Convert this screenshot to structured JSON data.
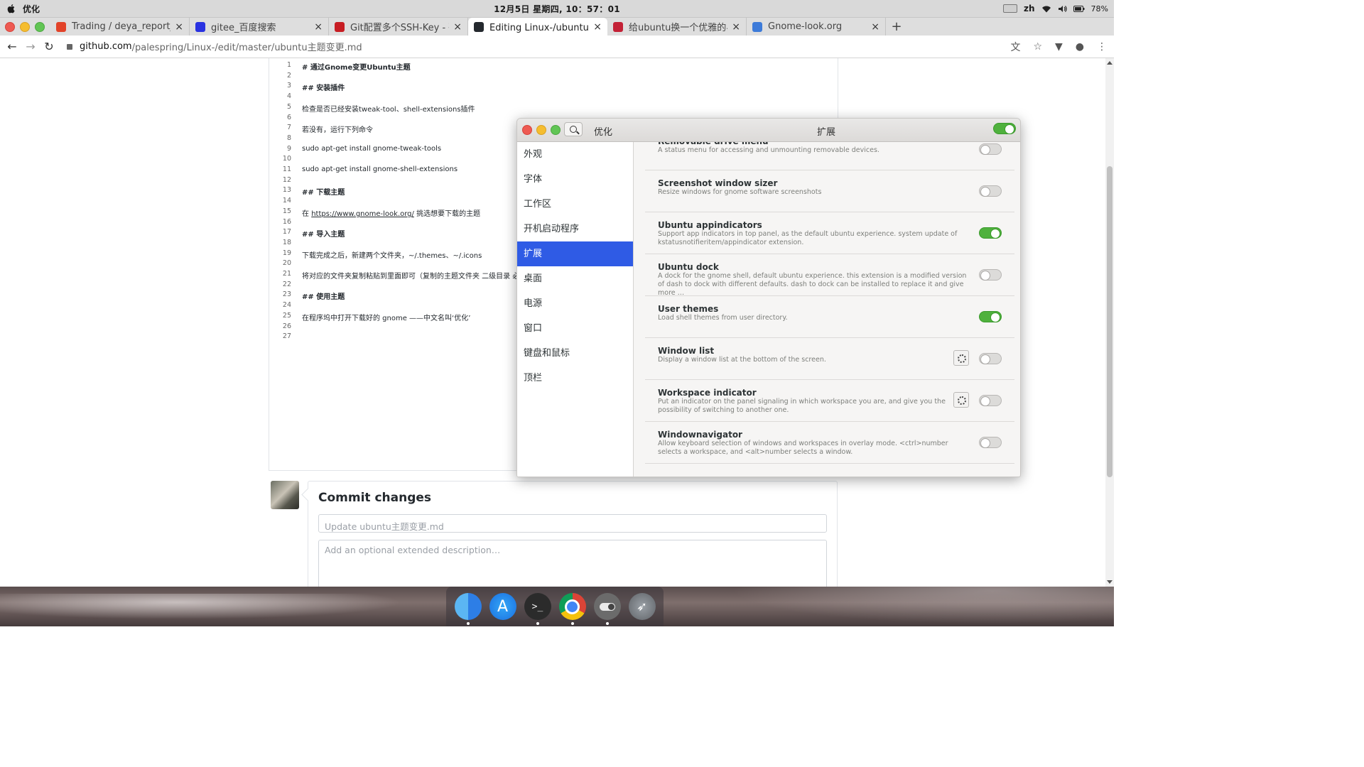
{
  "topbar": {
    "app_name": "优化",
    "clock": "12月5日 星期四, 10：57：01",
    "lang": "zh",
    "battery": "78%"
  },
  "tabs": [
    {
      "title": "Trading / deya_report_ui",
      "favicon": "gitlab-icon",
      "color": "#e24329"
    },
    {
      "title": "gitee_百度搜索",
      "favicon": "baidu-icon",
      "color": "#2932e1"
    },
    {
      "title": "Git配置多个SSH-Key - 码云",
      "favicon": "gitee-icon",
      "color": "#c71d23"
    },
    {
      "title": "Editing Linux-/ubuntu主题变更",
      "favicon": "github-icon",
      "color": "#24292e",
      "active": true
    },
    {
      "title": "给ubuntu换一个优雅的界面",
      "favicon": "csdn-icon",
      "color": "#c32136"
    },
    {
      "title": "Gnome-look.org",
      "favicon": "doc-icon",
      "color": "#3d7bd9"
    }
  ],
  "address": {
    "host": "github.com",
    "path": "/palespring/Linux-/edit/master/ubuntu主题变更.md"
  },
  "editor": {
    "lines": [
      {
        "n": "1",
        "text": "# 通过Gnome变更Ubuntu主题",
        "bold": true
      },
      {
        "n": "2",
        "text": ""
      },
      {
        "n": "3",
        "text": "## 安装插件",
        "bold": true
      },
      {
        "n": "4",
        "text": ""
      },
      {
        "n": "5",
        "text": "检查是否已经安装tweak-tool、shell-extensions插件"
      },
      {
        "n": "6",
        "text": ""
      },
      {
        "n": "7",
        "text": "若没有，运行下列命令"
      },
      {
        "n": "8",
        "text": ""
      },
      {
        "n": "9",
        "text": "   sudo apt-get install gnome-tweak-tools"
      },
      {
        "n": "10",
        "text": ""
      },
      {
        "n": "11",
        "text": "   sudo apt-get install gnome-shell-extensions"
      },
      {
        "n": "12",
        "text": ""
      },
      {
        "n": "13",
        "text": "## 下载主题",
        "bold": true
      },
      {
        "n": "14",
        "text": ""
      },
      {
        "n": "15",
        "text": "在 ",
        "link": "https://www.gnome-look.org/",
        "after": " 挑选想要下载的主题"
      },
      {
        "n": "16",
        "text": ""
      },
      {
        "n": "17",
        "text": "## 导入主题",
        "bold": true
      },
      {
        "n": "18",
        "text": ""
      },
      {
        "n": "19",
        "text": "下载完成之后，新建两个文件夹，~/.themes、~/.icons"
      },
      {
        "n": "20",
        "text": ""
      },
      {
        "n": "21",
        "text": "将对应的文件夹复制粘贴到里面即可（复制的主题文件夹 二级目录 必须"
      },
      {
        "n": "22",
        "text": ""
      },
      {
        "n": "23",
        "text": "## 使用主题",
        "bold": true
      },
      {
        "n": "24",
        "text": ""
      },
      {
        "n": "25",
        "text": "在程序坞中打开下载好的 gnome ——中文名叫‘优化’"
      },
      {
        "n": "26",
        "text": ""
      },
      {
        "n": "27",
        "text": ""
      }
    ]
  },
  "commit": {
    "heading": "Commit changes",
    "summary_placeholder": "Update ubuntu主题变更.md",
    "description_placeholder": "Add an optional extended description…"
  },
  "tweaks": {
    "title": "优化",
    "subtitle": "扩展",
    "master_switch_on": true,
    "sidebar": [
      {
        "label": "外观"
      },
      {
        "label": "字体"
      },
      {
        "label": "工作区"
      },
      {
        "label": "开机启动程序"
      },
      {
        "label": "扩展",
        "selected": true
      },
      {
        "label": "桌面"
      },
      {
        "label": "电源"
      },
      {
        "label": "窗口"
      },
      {
        "label": "键盘和鼠标"
      },
      {
        "label": "顶栏"
      }
    ],
    "extensions": [
      {
        "name": "Removable drive menu",
        "desc": "A status menu for accessing and unmounting removable devices.",
        "on": false,
        "gear": false
      },
      {
        "name": "Screenshot window sizer",
        "desc": "Resize windows for gnome software screenshots",
        "on": false,
        "gear": false
      },
      {
        "name": "Ubuntu appindicators",
        "desc": "Support app indicators in top panel, as the default ubuntu experience. system update of kstatusnotifieritem/appindicator extension.",
        "on": true,
        "gear": false
      },
      {
        "name": "Ubuntu dock",
        "desc": "A dock for the gnome shell, default ubuntu experience. this extension is a modified version of dash to dock with different defaults. dash to dock can be installed to replace it and give more …",
        "on": false,
        "gear": false
      },
      {
        "name": "User themes",
        "desc": "Load shell themes from user directory.",
        "on": true,
        "gear": false
      },
      {
        "name": "Window list",
        "desc": "Display a window list at the bottom of the screen.",
        "on": false,
        "gear": true
      },
      {
        "name": "Workspace indicator",
        "desc": "Put an indicator on the panel signaling in which workspace you are, and give you the possibility of switching to another one.",
        "on": false,
        "gear": true
      },
      {
        "name": "Windownavigator",
        "desc": "Allow keyboard selection of windows and workspaces in overlay mode. <ctrl>number selects a workspace, and <alt>number selects a window.",
        "on": false,
        "gear": false
      }
    ]
  },
  "dock": [
    {
      "name": "finder-icon",
      "running": true
    },
    {
      "name": "app-store-icon",
      "running": false
    },
    {
      "name": "terminal-icon",
      "running": true
    },
    {
      "name": "chrome-icon",
      "running": true
    },
    {
      "name": "tweaks-icon",
      "running": true
    },
    {
      "name": "launchpad-icon",
      "running": false
    }
  ]
}
